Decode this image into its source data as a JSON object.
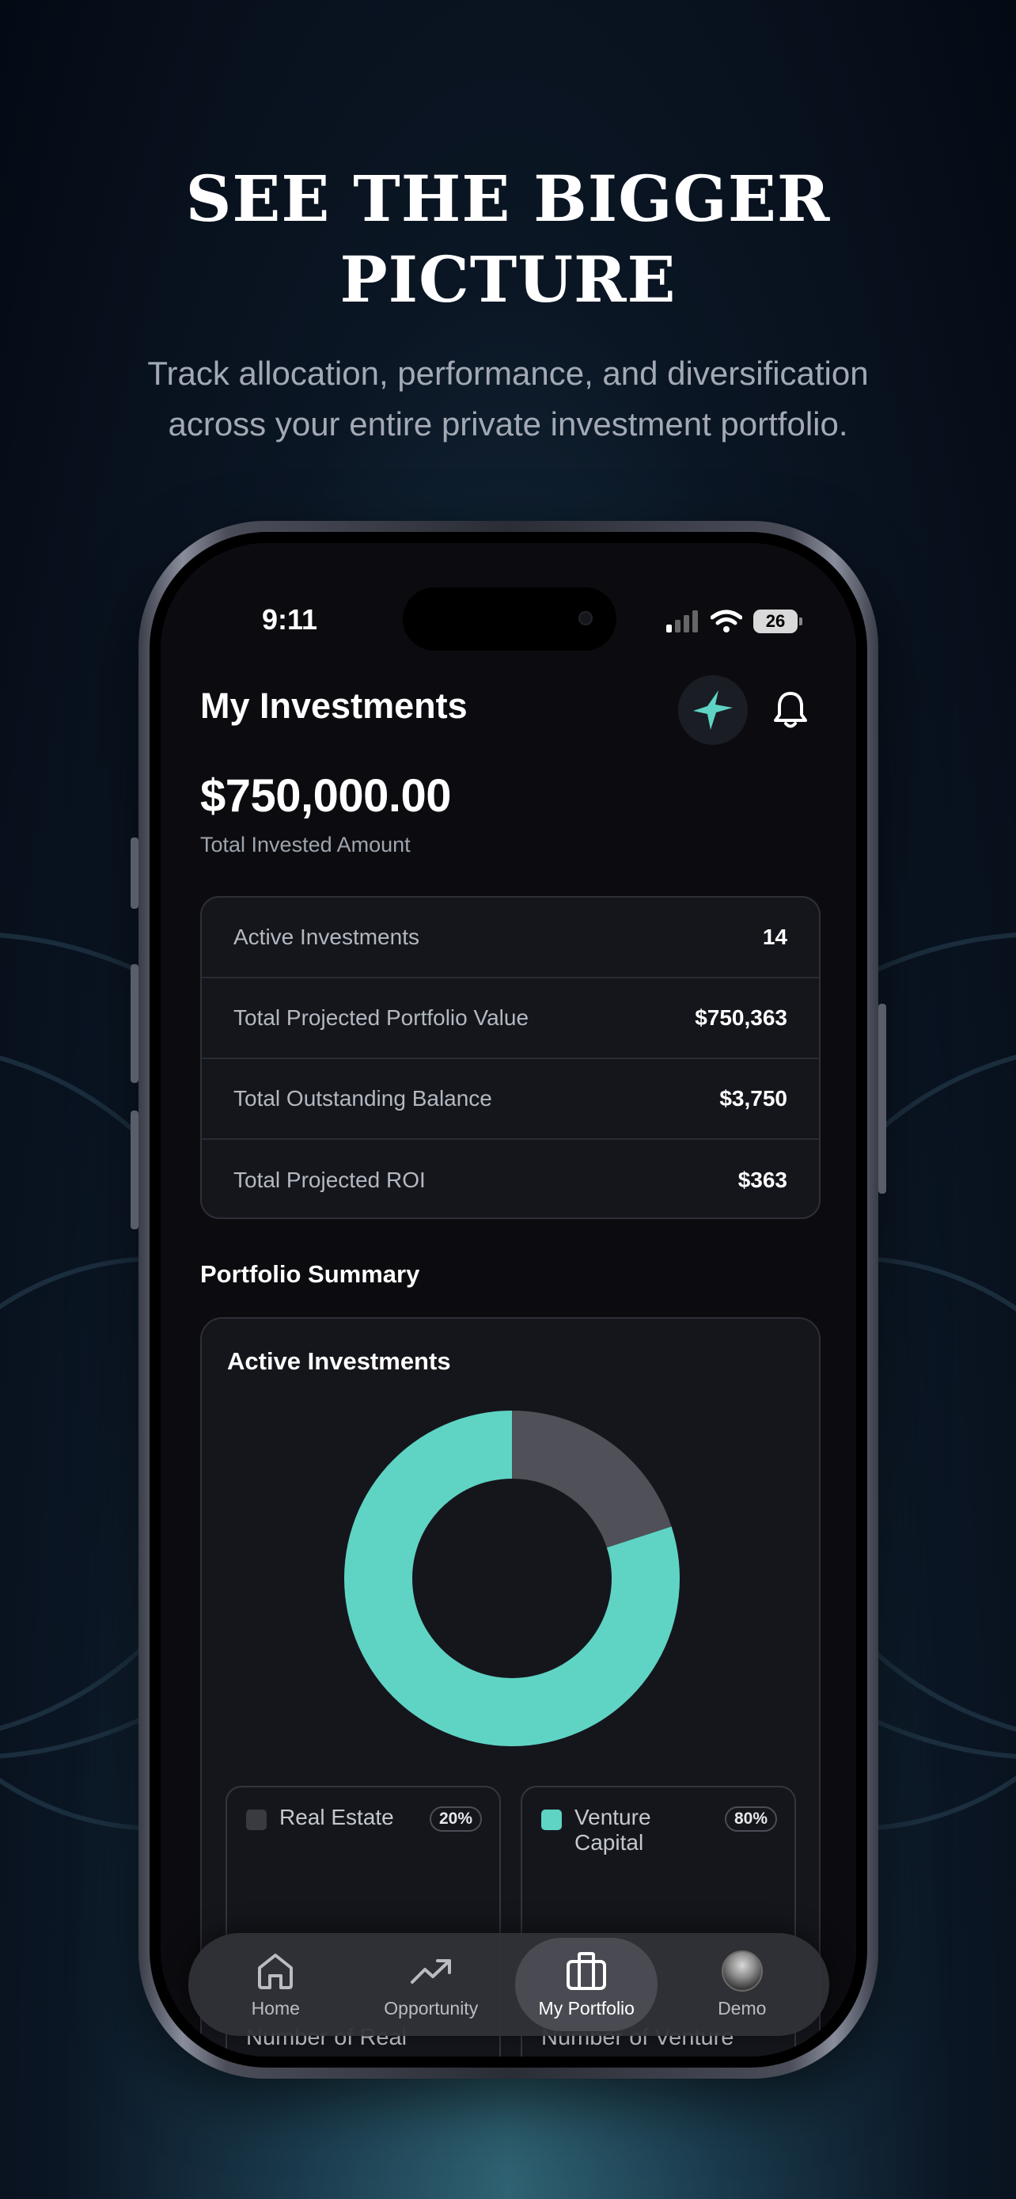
{
  "promo": {
    "headline_line1": "SEE THE BIGGER",
    "headline_line2": "PICTURE",
    "subheading_line1": "Track allocation, performance, and diversification",
    "subheading_line2": "across your entire private investment portfolio."
  },
  "status_bar": {
    "time": "9:11",
    "battery": "26"
  },
  "header": {
    "title": "My Investments",
    "ai_icon": "sparkle-icon",
    "notification_icon": "bell-icon"
  },
  "summary": {
    "total_amount": "$750,000.00",
    "total_label": "Total Invested Amount"
  },
  "stats": [
    {
      "label": "Active Investments",
      "value": "14"
    },
    {
      "label": "Total Projected Portfolio Value",
      "value": "$750,363"
    },
    {
      "label": "Total Outstanding Balance",
      "value": "$3,750"
    },
    {
      "label": "Total Projected ROI",
      "value": "$363"
    }
  ],
  "portfolio_summary": {
    "section_title": "Portfolio Summary",
    "card_title": "Active Investments"
  },
  "chart_data": {
    "type": "pie",
    "donut": true,
    "series": [
      {
        "name": "Real Estate",
        "value": 20,
        "label": "20%",
        "color": "#4f5058"
      },
      {
        "name": "Venture Capital",
        "value": 80,
        "label": "80%",
        "color": "#5fd4c4"
      }
    ]
  },
  "legend_cards": [
    {
      "name": "Real Estate",
      "pct": "20%",
      "sub": "Number of Real",
      "color": "#3a3b42"
    },
    {
      "name": "Venture Capital",
      "pct": "80%",
      "sub": "Number of Venture",
      "color": "#5fd4c4"
    }
  ],
  "nav": [
    {
      "label": "Home",
      "icon": "home-icon"
    },
    {
      "label": "Opportunity",
      "icon": "trending-up-icon"
    },
    {
      "label": "My Portfolio",
      "icon": "briefcase-icon",
      "active": true
    },
    {
      "label": "Demo",
      "icon": "avatar"
    }
  ],
  "colors": {
    "accent": "#5fd4c4",
    "background": "#0c0c10",
    "card": "#15161c"
  }
}
